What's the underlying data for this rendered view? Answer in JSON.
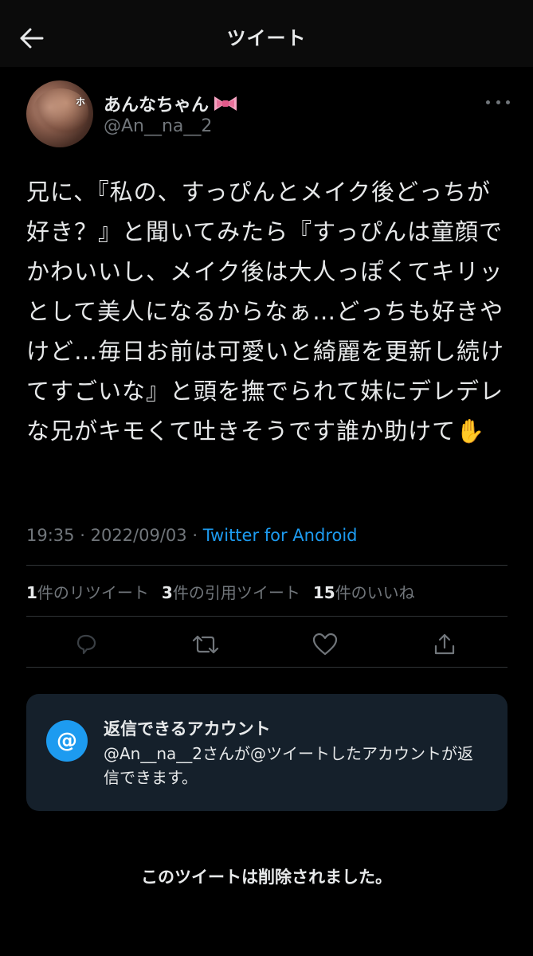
{
  "header": {
    "title": "ツイート",
    "back_icon": "arrow-left-icon"
  },
  "author": {
    "display_name": "あんなちゃん",
    "name_emoji": "ribbon-icon",
    "handle": "@An__na__2",
    "avatar_text": "ホ"
  },
  "tweet": {
    "text": "兄に、『私の、すっぴんとメイク後どっちが好き？』と聞いてみたら『すっぴんは童顔でかわいいし、メイク後は大人っぽくてキリッとして美人になるからなぁ…どっちも好きやけど…毎日お前は可愛いと綺麗を更新し続けてすごいな』と頭を撫でられて妹にデレデレな兄がキモくて吐きそうです誰か助けて✋",
    "time": "19:35",
    "separator": "·",
    "date": "2022/09/03",
    "source": "Twitter for Android"
  },
  "stats": {
    "retweets_count": "1",
    "retweets_label": "件のリツイート",
    "quotes_count": "3",
    "quotes_label": "件の引用ツイート",
    "likes_count": "15",
    "likes_label": "件のいいね"
  },
  "actions": [
    "reply-icon",
    "retweet-icon",
    "like-icon",
    "share-icon"
  ],
  "reply_restriction": {
    "icon_text": "@",
    "title": "返信できるアカウント",
    "text": "@An__na__2さんが@ツイートしたアカウントが返信できます。"
  },
  "notice": "このツイートは削除されました。",
  "colors": {
    "background": "#000000",
    "text": "#e7e9ea",
    "secondary": "#71767b",
    "accent": "#1d9bf0",
    "card": "#15202b"
  }
}
